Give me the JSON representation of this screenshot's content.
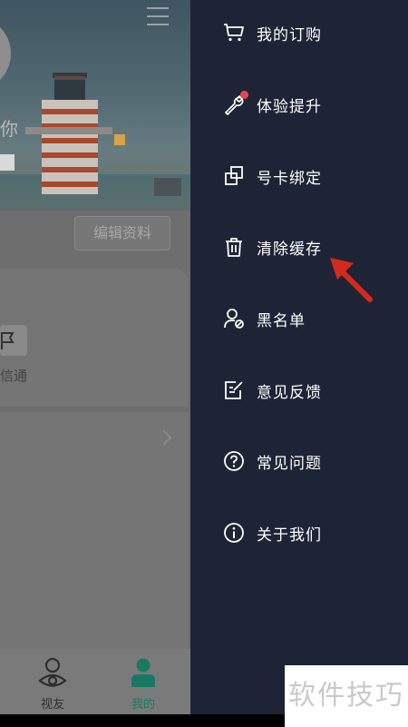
{
  "profile": {
    "name_fragment": "你",
    "edit_button": "编辑资料",
    "card_item_label": "信通"
  },
  "tabbar": {
    "tabs": [
      {
        "label": "视友",
        "icon": "eye-person-icon",
        "active": false
      },
      {
        "label": "我的",
        "icon": "person-icon",
        "active": true
      }
    ],
    "active_color": "#1a7a61"
  },
  "drawer": {
    "background": "#1e2436",
    "items": [
      {
        "label": "我的订购",
        "icon": "cart-icon"
      },
      {
        "label": "体验提升",
        "icon": "wrench-icon",
        "badge": "red-dot"
      },
      {
        "label": "号卡绑定",
        "icon": "link-squares-icon"
      },
      {
        "label": "清除缓存",
        "icon": "trash-icon"
      },
      {
        "label": "黑名单",
        "icon": "user-block-icon"
      },
      {
        "label": "意见反馈",
        "icon": "feedback-icon"
      },
      {
        "label": "常见问题",
        "icon": "question-icon"
      },
      {
        "label": "关于我们",
        "icon": "info-icon"
      }
    ]
  },
  "annotation": {
    "arrow_color": "#d42a1e",
    "target": "清除缓存"
  },
  "watermark": "软件技巧"
}
